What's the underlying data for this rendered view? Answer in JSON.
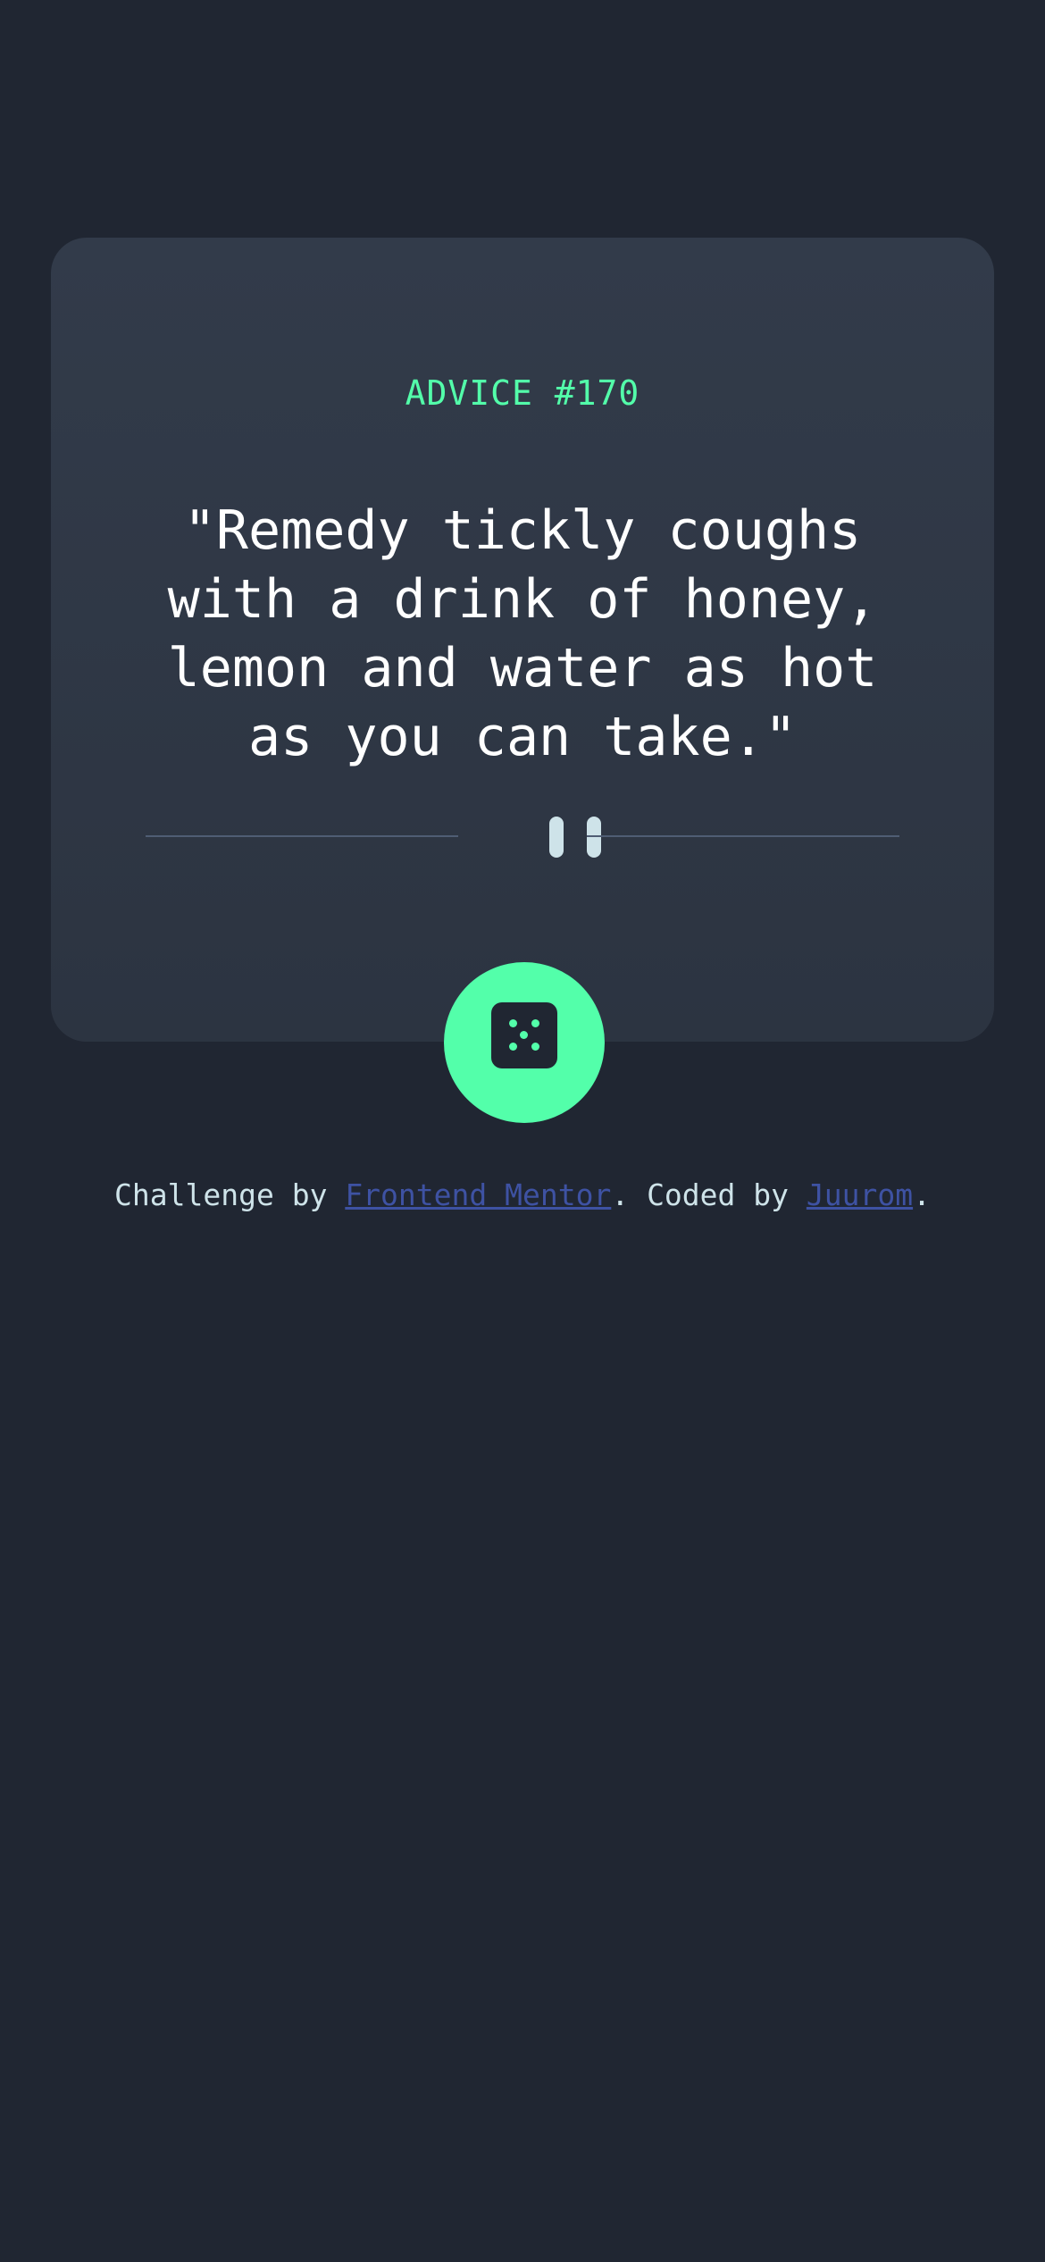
{
  "card": {
    "heading": "ADVICE #170",
    "quote": "\"Remedy tickly coughs with a drink of honey, lemon and water as hot as you can take.\""
  },
  "icons": {
    "divider": "pause-icon",
    "button": "dice-icon"
  },
  "footer": {
    "challenge_prefix": "Challenge by ",
    "challenge_link": "Frontend Mentor",
    "coded_prefix": ". Coded by ",
    "author_link": "Juurom",
    "suffix": "."
  },
  "colors": {
    "background": "#202632",
    "card": "#313a48",
    "accent": "#53ffaa",
    "link": "#3e52a3",
    "text": "#cee3e9"
  }
}
